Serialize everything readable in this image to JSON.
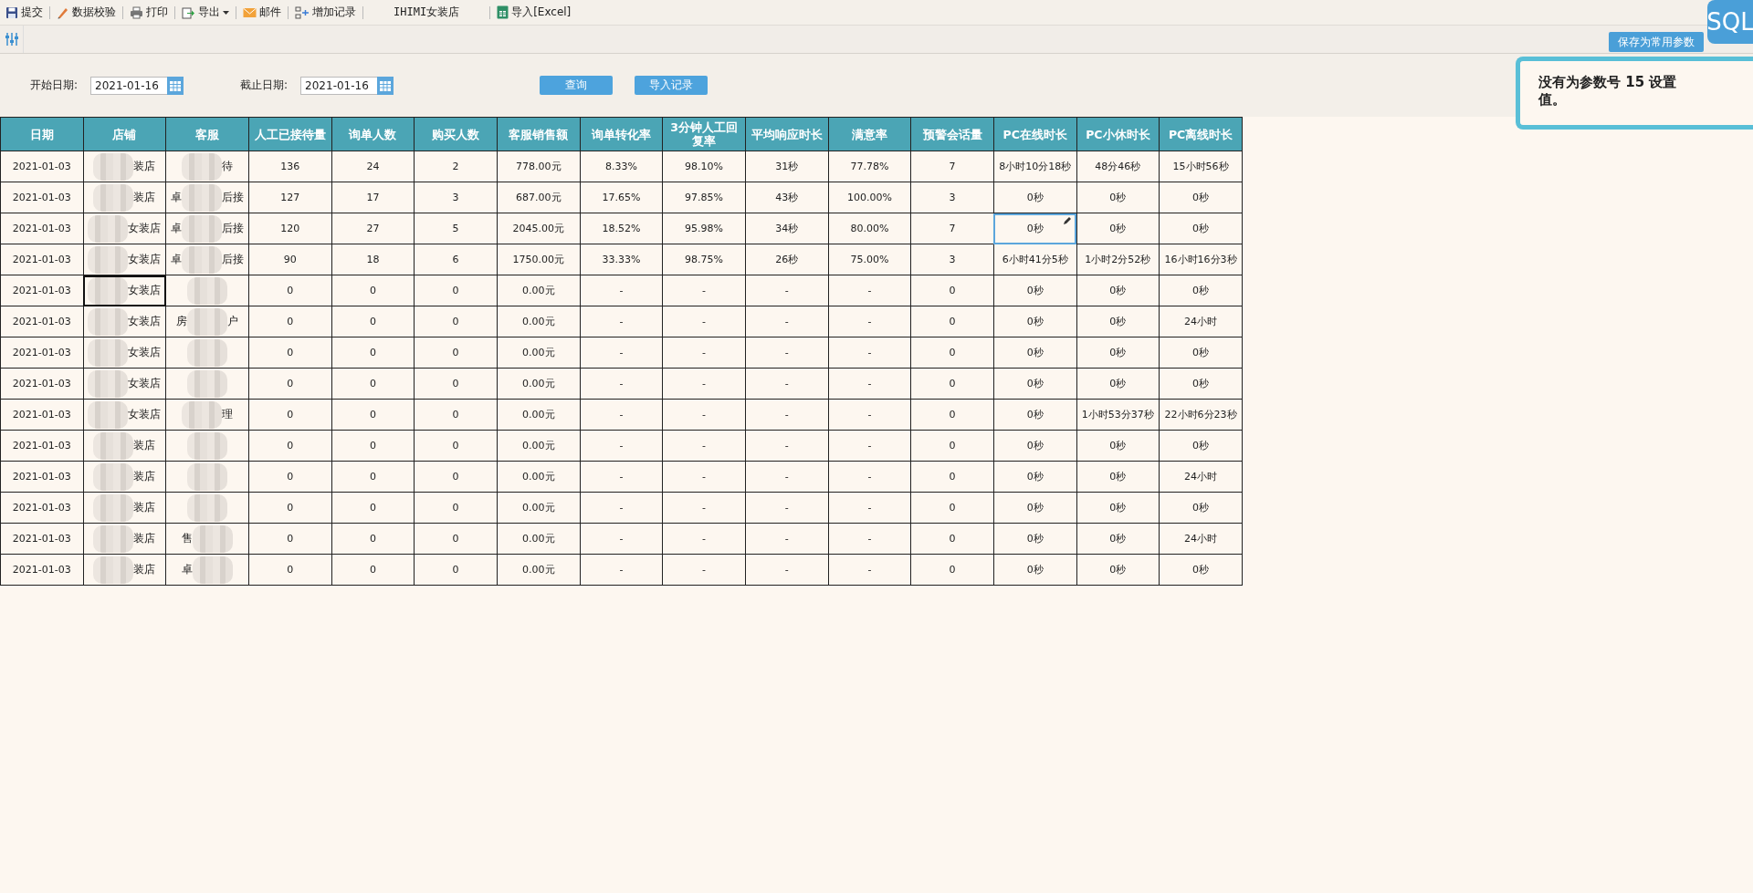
{
  "toolbar": [
    {
      "label": "提交",
      "kind": "button"
    },
    {
      "label": "数据校验",
      "kind": "button"
    },
    {
      "label": "打印",
      "kind": "button"
    },
    {
      "label": "导出",
      "kind": "menu"
    },
    {
      "label": "邮件",
      "kind": "button"
    },
    {
      "label": "增加记录",
      "kind": "button"
    },
    {
      "label": "IHIMI女装店",
      "kind": "label"
    },
    {
      "label": "导入[Excel]",
      "kind": "button"
    }
  ],
  "param_bar": {
    "save_button": "保存为常用参数",
    "sql_badge": "SQL"
  },
  "params": {
    "start_label": "开始日期:",
    "start_value": "2021-01-16",
    "end_label": "截止日期:",
    "end_value": "2021-01-16",
    "query_button": "查询",
    "import_button": "导入记录"
  },
  "notice": "没有为参数号 15 设置值。",
  "table": {
    "columns": [
      "日期",
      "店铺",
      "客服",
      "人工已接待量",
      "询单人数",
      "购买人数",
      "客服销售额",
      "询单转化率",
      "3分钟人工回复率",
      "平均响应时长",
      "满意率",
      "预警会话量",
      "PC在线时长",
      "PC小休时长",
      "PC离线时长"
    ],
    "rows": [
      {
        "date": "2021-01-03",
        "shop": {
          "text": "装店",
          "selected": false
        },
        "service": {
          "suffix": "待"
        },
        "values": [
          "136",
          "24",
          "2",
          "778.00元",
          "8.33%",
          "98.10%",
          "31秒",
          "77.78%",
          "7"
        ],
        "pc": [
          {
            "text": "8小时10分18秒",
            "editing": false
          },
          {
            "text": "48分46秒",
            "editing": false
          },
          {
            "text": "15小时56秒",
            "editing": false
          }
        ]
      },
      {
        "date": "2021-01-03",
        "shop": {
          "text": "装店",
          "selected": false
        },
        "service": {
          "prefix": "卓",
          "suffix": "后接"
        },
        "values": [
          "127",
          "17",
          "3",
          "687.00元",
          "17.65%",
          "97.85%",
          "43秒",
          "100.00%",
          "3"
        ],
        "pc": [
          {
            "text": "0秒",
            "editing": false
          },
          {
            "text": "0秒",
            "editing": false
          },
          {
            "text": "0秒",
            "editing": false
          }
        ]
      },
      {
        "date": "2021-01-03",
        "shop": {
          "text": "女装店",
          "selected": false
        },
        "service": {
          "prefix": "卓",
          "suffix": "后接"
        },
        "values": [
          "120",
          "27",
          "5",
          "2045.00元",
          "18.52%",
          "95.98%",
          "34秒",
          "80.00%",
          "7"
        ],
        "pc": [
          {
            "text": "0秒",
            "editing": true
          },
          {
            "text": "0秒",
            "editing": false
          },
          {
            "text": "0秒",
            "editing": false
          }
        ]
      },
      {
        "date": "2021-01-03",
        "shop": {
          "text": "女装店",
          "selected": false
        },
        "service": {
          "prefix": "卓",
          "suffix": "后接"
        },
        "values": [
          "90",
          "18",
          "6",
          "1750.00元",
          "33.33%",
          "98.75%",
          "26秒",
          "75.00%",
          "3"
        ],
        "pc": [
          {
            "text": "6小时41分5秒",
            "editing": false
          },
          {
            "text": "1小时2分52秒",
            "editing": false
          },
          {
            "text": "16小时16分3秒",
            "editing": false
          }
        ]
      },
      {
        "date": "2021-01-03",
        "shop": {
          "text": "女装店",
          "selected": true
        },
        "service": {},
        "values": [
          "0",
          "0",
          "0",
          "0.00元",
          "-",
          "-",
          "-",
          "-",
          "0"
        ],
        "pc": [
          {
            "text": "0秒",
            "editing": false
          },
          {
            "text": "0秒",
            "editing": false
          },
          {
            "text": "0秒",
            "editing": false
          }
        ]
      },
      {
        "date": "2021-01-03",
        "shop": {
          "text": "女装店",
          "selected": false
        },
        "service": {
          "prefix": "房",
          "suffix": "户"
        },
        "values": [
          "0",
          "0",
          "0",
          "0.00元",
          "-",
          "-",
          "-",
          "-",
          "0"
        ],
        "pc": [
          {
            "text": "0秒",
            "editing": false
          },
          {
            "text": "0秒",
            "editing": false
          },
          {
            "text": "24小时",
            "editing": false
          }
        ]
      },
      {
        "date": "2021-01-03",
        "shop": {
          "text": "女装店",
          "selected": false
        },
        "service": {},
        "values": [
          "0",
          "0",
          "0",
          "0.00元",
          "-",
          "-",
          "-",
          "-",
          "0"
        ],
        "pc": [
          {
            "text": "0秒",
            "editing": false
          },
          {
            "text": "0秒",
            "editing": false
          },
          {
            "text": "0秒",
            "editing": false
          }
        ]
      },
      {
        "date": "2021-01-03",
        "shop": {
          "text": "女装店",
          "selected": false
        },
        "service": {},
        "values": [
          "0",
          "0",
          "0",
          "0.00元",
          "-",
          "-",
          "-",
          "-",
          "0"
        ],
        "pc": [
          {
            "text": "0秒",
            "editing": false
          },
          {
            "text": "0秒",
            "editing": false
          },
          {
            "text": "0秒",
            "editing": false
          }
        ]
      },
      {
        "date": "2021-01-03",
        "shop": {
          "text": "女装店",
          "selected": false
        },
        "service": {
          "suffix": "理"
        },
        "values": [
          "0",
          "0",
          "0",
          "0.00元",
          "-",
          "-",
          "-",
          "-",
          "0"
        ],
        "pc": [
          {
            "text": "0秒",
            "editing": false
          },
          {
            "text": "1小时53分37秒",
            "editing": false
          },
          {
            "text": "22小时6分23秒",
            "editing": false
          }
        ]
      },
      {
        "date": "2021-01-03",
        "shop": {
          "text": "装店",
          "selected": false
        },
        "service": {},
        "values": [
          "0",
          "0",
          "0",
          "0.00元",
          "-",
          "-",
          "-",
          "-",
          "0"
        ],
        "pc": [
          {
            "text": "0秒",
            "editing": false
          },
          {
            "text": "0秒",
            "editing": false
          },
          {
            "text": "0秒",
            "editing": false
          }
        ]
      },
      {
        "date": "2021-01-03",
        "shop": {
          "text": "装店",
          "selected": false
        },
        "service": {},
        "values": [
          "0",
          "0",
          "0",
          "0.00元",
          "-",
          "-",
          "-",
          "-",
          "0"
        ],
        "pc": [
          {
            "text": "0秒",
            "editing": false
          },
          {
            "text": "0秒",
            "editing": false
          },
          {
            "text": "24小时",
            "editing": false
          }
        ]
      },
      {
        "date": "2021-01-03",
        "shop": {
          "text": "装店",
          "selected": false
        },
        "service": {},
        "values": [
          "0",
          "0",
          "0",
          "0.00元",
          "-",
          "-",
          "-",
          "-",
          "0"
        ],
        "pc": [
          {
            "text": "0秒",
            "editing": false
          },
          {
            "text": "0秒",
            "editing": false
          },
          {
            "text": "0秒",
            "editing": false
          }
        ]
      },
      {
        "date": "2021-01-03",
        "shop": {
          "text": "装店",
          "selected": false
        },
        "service": {
          "prefix": "售"
        },
        "values": [
          "0",
          "0",
          "0",
          "0.00元",
          "-",
          "-",
          "-",
          "-",
          "0"
        ],
        "pc": [
          {
            "text": "0秒",
            "editing": false
          },
          {
            "text": "0秒",
            "editing": false
          },
          {
            "text": "24小时",
            "editing": false
          }
        ]
      },
      {
        "date": "2021-01-03",
        "shop": {
          "text": "装店",
          "selected": false
        },
        "service": {
          "prefix": "卓"
        },
        "values": [
          "0",
          "0",
          "0",
          "0.00元",
          "-",
          "-",
          "-",
          "-",
          "0"
        ],
        "pc": [
          {
            "text": "0秒",
            "editing": false
          },
          {
            "text": "0秒",
            "editing": false
          },
          {
            "text": "0秒",
            "editing": false
          }
        ]
      }
    ]
  }
}
